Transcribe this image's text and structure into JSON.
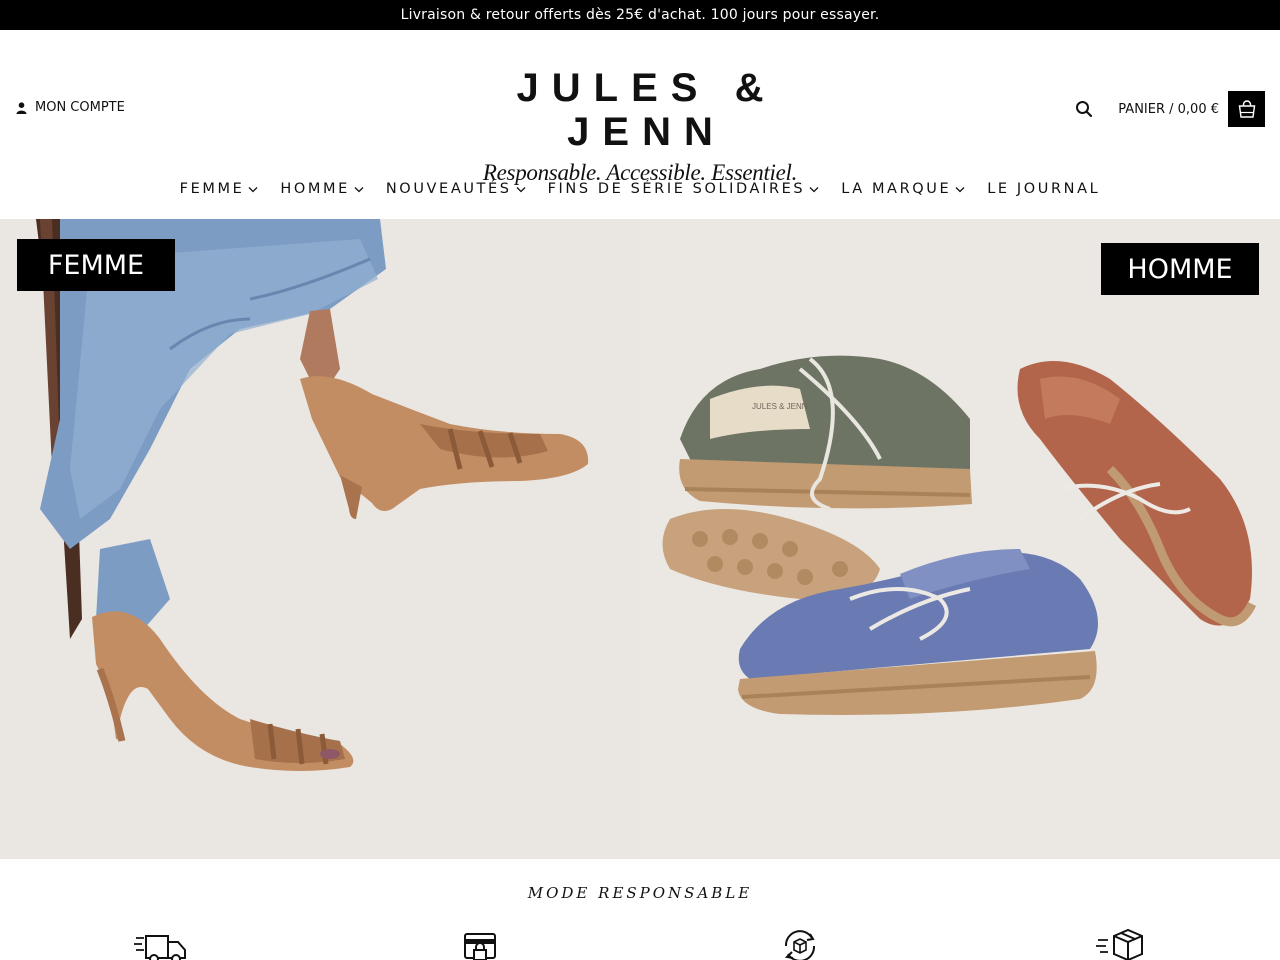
{
  "announcement": "Livraison & retour offerts dès 25€ d'achat. 100 jours pour essayer.",
  "header": {
    "account_label": "MON COMPTE",
    "logo_wordmark": "JULES & JENN",
    "logo_tagline": "Responsable. Accessible. Essentiel.",
    "cart_label": "PANIER / 0,00 €"
  },
  "nav": {
    "items": [
      {
        "label": "FEMME",
        "dropdown": true
      },
      {
        "label": "HOMME",
        "dropdown": true
      },
      {
        "label": "NOUVEAUTÉS",
        "dropdown": true
      },
      {
        "label": "FINS DE SÉRIE SOLIDAIRES",
        "dropdown": true
      },
      {
        "label": "LA MARQUE",
        "dropdown": true
      },
      {
        "label": "LE JOURNAL",
        "dropdown": false
      }
    ]
  },
  "hero": {
    "left_label": "FEMME",
    "right_label": "HOMME"
  },
  "features": {
    "title": "MODE RESPONSABLE",
    "icons": [
      "delivery-truck-icon",
      "secure-payment-icon",
      "returns-box-icon",
      "fast-shipping-box-icon"
    ]
  },
  "colors": {
    "announcement_bg": "#000000",
    "hero_bg": "#e9e5e1",
    "label_bg": "#000000"
  }
}
